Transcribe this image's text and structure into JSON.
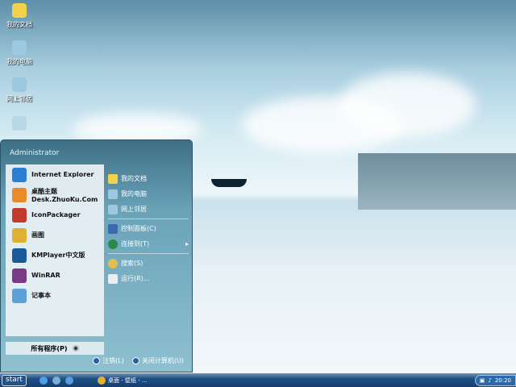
{
  "desktop": {
    "icons": [
      {
        "label": "我的文档"
      },
      {
        "label": "我的电脑"
      },
      {
        "label": "网上邻居"
      }
    ]
  },
  "start_menu": {
    "user": "Administrator",
    "programs": [
      {
        "label": "Internet Explorer",
        "color": "#2a7fd4"
      },
      {
        "label": "桌酷主题",
        "sub": "Desk.ZhuoKu.Com",
        "color": "#e88a2a"
      },
      {
        "label": "IconPackager",
        "color": "#c23a2a"
      },
      {
        "label": "画图",
        "color": "#e0b030"
      },
      {
        "label": "KMPlayer中文版",
        "color": "#1b5a9a"
      },
      {
        "label": "WinRAR",
        "color": "#7a3a8a"
      },
      {
        "label": "记事本",
        "color": "#5ca0d8"
      }
    ],
    "all_programs": "所有程序(P)",
    "places": [
      {
        "label": "我的文档",
        "color": "#f2d24a"
      },
      {
        "label": "我的电脑",
        "color": "#9cc8e0"
      },
      {
        "label": "网上邻居",
        "color": "#9cc8e0"
      },
      {
        "label": "控制面板(C)",
        "color": "#3a6ab0"
      },
      {
        "label": "连接到(T)",
        "color": "#2a8a4a",
        "arrow": "▸"
      },
      {
        "label": "搜索(S)",
        "color": "#e0c050"
      },
      {
        "label": "运行(R)...",
        "color": "#e8eef2"
      }
    ],
    "logoff": "注销(L)",
    "shutdown": "关闭计算机(U)"
  },
  "taskbar": {
    "start": "start",
    "task": "桌面 - 壁纸 - ...",
    "clock": "20:20"
  }
}
